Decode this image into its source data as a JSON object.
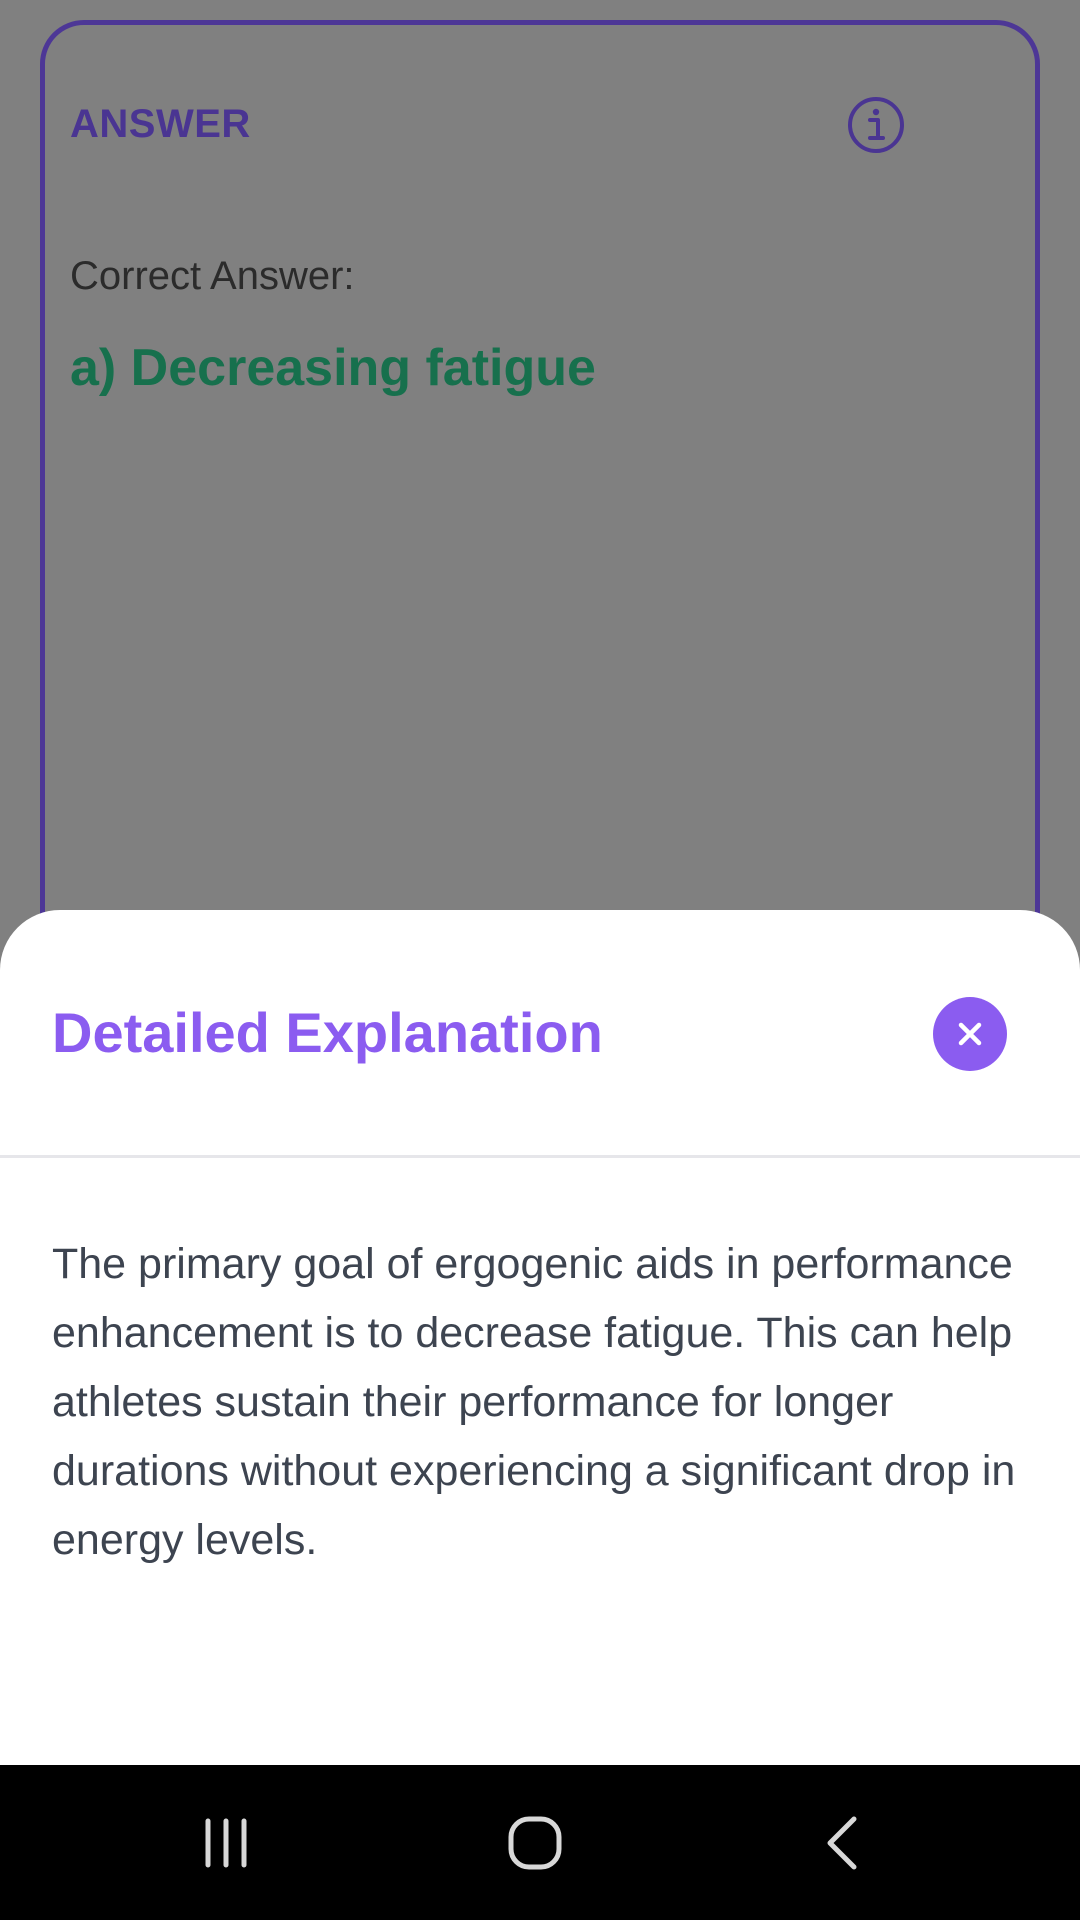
{
  "answer_card": {
    "heading": "ANSWER",
    "info_icon": "info-icon",
    "correct_label": "Correct Answer:",
    "correct_value": "a) Decreasing fatigue"
  },
  "sheet": {
    "title": "Detailed Explanation",
    "close_icon": "close-icon",
    "explanation": "The primary goal of ergogenic aids in performance enhancement is to decrease fatigue. This can help athletes sustain their performance for longer durations without experiencing a significant drop in energy levels."
  },
  "nav_bar": {
    "recents_icon": "recents-icon",
    "home_icon": "home-icon",
    "back_icon": "back-icon"
  },
  "colors": {
    "accent": "#8b5cf0",
    "card_border": "#4d3796",
    "correct": "#17704d",
    "overlay": "#808080"
  }
}
